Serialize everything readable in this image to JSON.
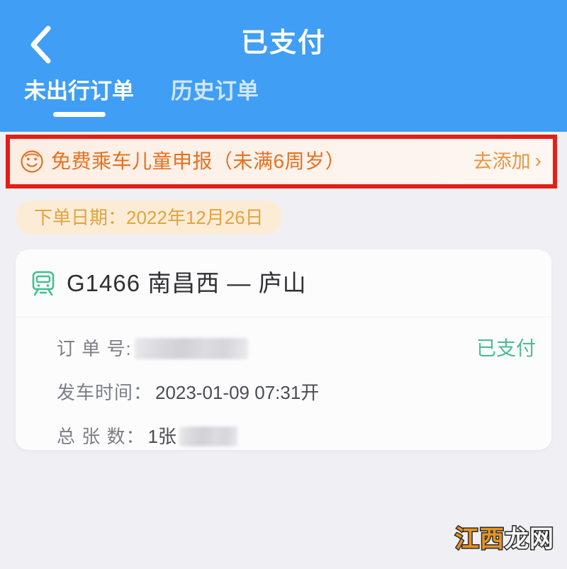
{
  "header": {
    "title": "已支付",
    "back_icon": "chevron-left-icon",
    "background_color": "#409ef4",
    "tabs": [
      {
        "label": "未出行订单",
        "active": true
      },
      {
        "label": "历史订单",
        "active": false
      }
    ]
  },
  "child_banner": {
    "icon": "child-face-icon",
    "text": "免费乘车儿童申报（未满6周岁）",
    "action_label": "去添加",
    "action_chevron": "›",
    "text_color": "#e8701f",
    "action_color": "#e9963f",
    "highlight_border_color": "#e21f18"
  },
  "order_date": {
    "label": "下单日期：",
    "value": "2022年12月26日",
    "full_text": "下单日期：2022年12月26日",
    "text_color": "#e2a43e",
    "background_color": "#fcecd6"
  },
  "order_card": {
    "train_icon": "train-icon",
    "train_icon_color": "#3fc28c",
    "train_title": "G1466  南昌西 — 庐山",
    "status": {
      "label": "已支付",
      "color": "#4ebd8e"
    },
    "details": [
      {
        "label": "订 单 号:",
        "value": "",
        "redacted": true
      },
      {
        "label": "发车时间：",
        "value": "2023-01-09  07:31开",
        "redacted": false
      },
      {
        "label": "总 张 数：",
        "value": "1张",
        "redacted": true
      }
    ]
  },
  "watermark": {
    "part_a": "江西",
    "part_b": "龙网",
    "color_a": "#e8941f",
    "color_b": "#f6f6f6"
  }
}
